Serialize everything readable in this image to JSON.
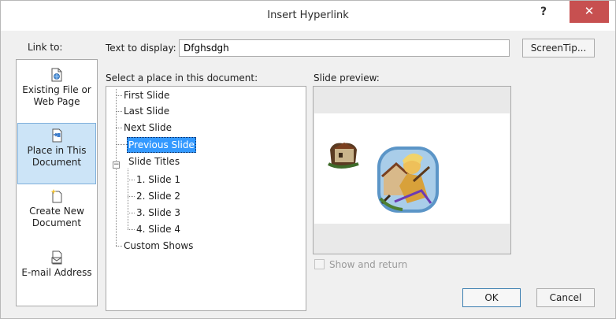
{
  "dialog": {
    "title": "Insert Hyperlink",
    "help_label": "?",
    "close_label": "✕"
  },
  "link_to": {
    "label": "Link to:",
    "items": [
      {
        "label": "Existing File or Web Page",
        "icon": "globe-file-icon",
        "selected": false
      },
      {
        "label": "Place in This Document",
        "icon": "document-place-icon",
        "selected": true
      },
      {
        "label": "Create New Document",
        "icon": "new-document-icon",
        "selected": false
      },
      {
        "label": "E-mail Address",
        "icon": "email-icon",
        "selected": false
      }
    ]
  },
  "text_to_display": {
    "label": "Text to display:",
    "value": "Dfghsdgh"
  },
  "screentip_label": "ScreenTip...",
  "place": {
    "label": "Select a place in this document:",
    "items": [
      "First Slide",
      "Last Slide",
      "Next Slide",
      "Previous Slide",
      "Slide Titles",
      "1. Slide 1",
      "2. Slide 2",
      "3. Slide 3",
      "4. Slide 4",
      "Custom Shows"
    ],
    "selected": "Previous Slide",
    "expander": "−"
  },
  "preview": {
    "label": "Slide preview:",
    "show_return_label": "Show and return",
    "show_return_checked": false
  },
  "buttons": {
    "ok": "OK",
    "cancel": "Cancel"
  },
  "colors": {
    "selection": "#3399ff",
    "close_button": "#c75050",
    "panel_selected": "#cce4f7"
  }
}
